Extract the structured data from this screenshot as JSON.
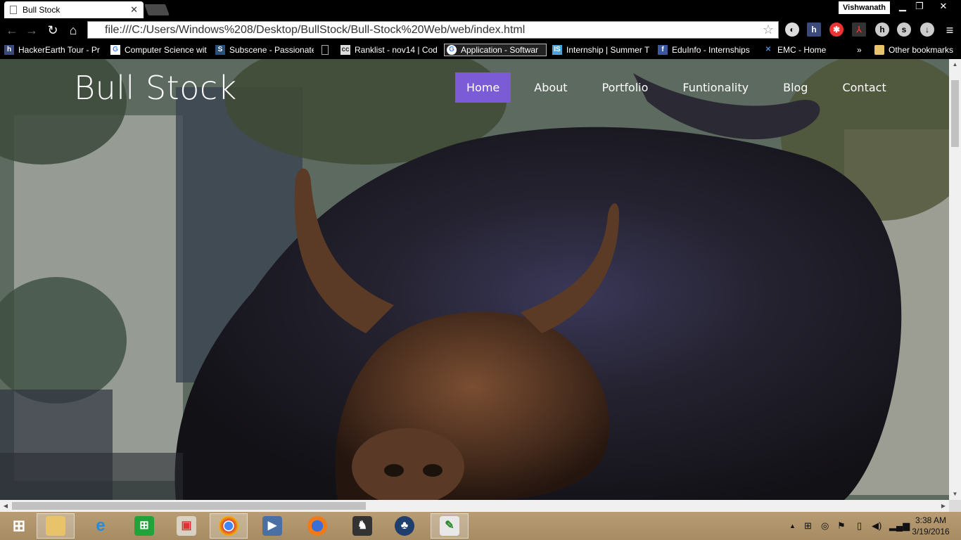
{
  "browser": {
    "tab_title": "Bull Stock",
    "profile_name": "Vishwanath",
    "url": "file:///C:/Users/Windows%208/Desktop/BullStock/Bull-Stock%20Web/web/index.html",
    "bookmarks": [
      {
        "label": "HackerEarth Tour - Pr",
        "icon": "hackerearth-icon"
      },
      {
        "label": "Computer Science wit",
        "icon": "google-icon"
      },
      {
        "label": "Subscene - Passionate",
        "icon": "subscene-icon"
      },
      {
        "label": "",
        "icon": "page-icon"
      },
      {
        "label": "Ranklist - nov14 | Cod",
        "icon": "codechef-icon"
      },
      {
        "label": "Application - Softwar",
        "icon": "google-icon"
      },
      {
        "label": "Internship | Summer T",
        "icon": "internshala-icon"
      },
      {
        "label": "EduInfo - Internships",
        "icon": "facebook-icon"
      },
      {
        "label": "EMC - Home",
        "icon": "emc-icon"
      }
    ],
    "overflow_label": "»",
    "other_bookmarks": "Other bookmarks"
  },
  "site": {
    "logo": "Bull Stock",
    "nav": [
      {
        "label": "Home",
        "active": true
      },
      {
        "label": "About",
        "active": false
      },
      {
        "label": "Portfolio",
        "active": false
      },
      {
        "label": "Funtionality",
        "active": false
      },
      {
        "label": "Blog",
        "active": false
      },
      {
        "label": "Contact",
        "active": false
      }
    ],
    "accent_color": "#7b5bd6"
  },
  "taskbar": {
    "time": "3:38 AM",
    "date": "3/19/2016"
  }
}
